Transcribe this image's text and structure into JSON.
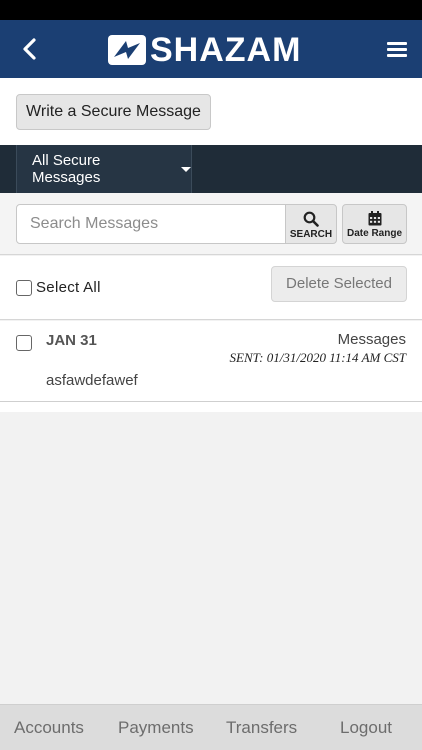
{
  "header": {
    "brand": "SHAZAM",
    "back_icon": "chevron-left-icon",
    "menu_icon": "hamburger-menu-icon",
    "brand_color": "#1b3f73"
  },
  "compose": {
    "label": "Write a Secure Message"
  },
  "filter": {
    "selected": "All Secure Messages"
  },
  "search": {
    "placeholder": "Search Messages",
    "search_label": "SEARCH",
    "date_range_label": "Date Range"
  },
  "selection": {
    "select_all_label": "Select All",
    "delete_label": "Delete Selected"
  },
  "messages": [
    {
      "date": "JAN 31",
      "type": "Messages",
      "sent": "SENT: 01/31/2020 11:14 AM CST",
      "subject": "asfawdefawef"
    }
  ],
  "nav": {
    "items": [
      "Accounts",
      "Payments",
      "Transfers",
      "Logout"
    ]
  }
}
